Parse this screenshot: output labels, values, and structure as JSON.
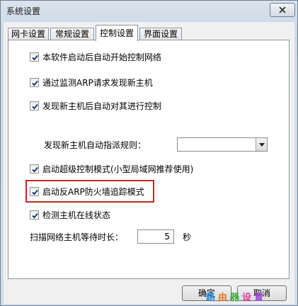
{
  "window": {
    "title": "系统设置"
  },
  "tabs": [
    {
      "label": "网卡设置"
    },
    {
      "label": "常规设置"
    },
    {
      "label": "控制设置"
    },
    {
      "label": "界面设置"
    }
  ],
  "active_tab": "控制设置",
  "options": {
    "auto_start_control": {
      "label": "本软件启动后自动开始控制网络",
      "checked": true
    },
    "arp_discover": {
      "label": "通过监测ARP请求发现新主机",
      "checked": true
    },
    "auto_control_new": {
      "label": "发现新主机后自动对其进行控制",
      "checked": true
    },
    "assign_rule": {
      "label": "发现新主机自动指派规则：",
      "value": ""
    },
    "super_mode": {
      "label": "启动超级控制模式(小型局域网推荐使用)",
      "checked": true
    },
    "anti_arp_firewall": {
      "label": "启动反ARP防火墙追踪模式",
      "checked": true
    },
    "detect_online": {
      "label": "检测主机在线状态",
      "checked": true
    },
    "scan_wait": {
      "label": "扫描网络主机等待时长：",
      "value": "5",
      "unit": "秒"
    }
  },
  "buttons": {
    "ok": "确定",
    "cancel": "取消"
  },
  "watermark": [
    "路",
    "由",
    "器",
    "设",
    "置"
  ],
  "colors": {
    "highlight": "#c62828",
    "check": "#1d3b7a"
  }
}
